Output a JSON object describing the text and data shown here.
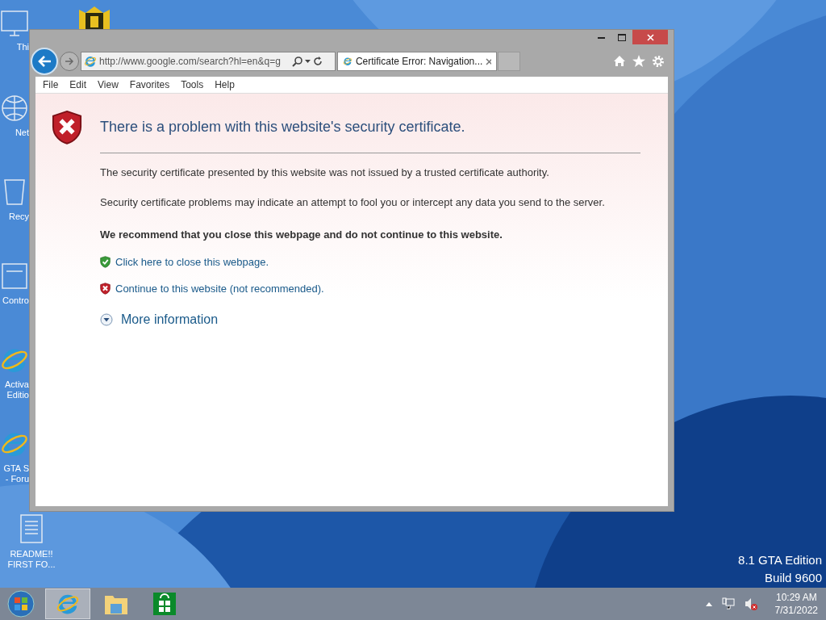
{
  "desktop_icons": [
    {
      "kind": "computer",
      "label": "Thi"
    },
    {
      "kind": "network",
      "label": "Net"
    },
    {
      "kind": "recycle",
      "label": "Recy"
    },
    {
      "kind": "control",
      "label": "Contro"
    },
    {
      "kind": "ie",
      "label": "Activa\nEditio"
    },
    {
      "kind": "ie",
      "label": "GTA S\n- Foru"
    },
    {
      "kind": "document",
      "label": "README!!\nFIRST FO..."
    }
  ],
  "browser": {
    "address": "http://www.google.com/search?hl=en&q=g",
    "tab_title": "Certificate Error: Navigation...",
    "menu": [
      "File",
      "Edit",
      "View",
      "Favorites",
      "Tools",
      "Help"
    ]
  },
  "page": {
    "heading": "There is a problem with this website's security certificate.",
    "paragraphs": [
      "The security certificate presented by this website was not issued by a trusted certificate authority.",
      "Security certificate problems may indicate an attempt to fool you or intercept any data you send to the server."
    ],
    "recommendation": "We recommend that you close this webpage and do not continue to this website.",
    "links": [
      {
        "kind": "safe",
        "text": "Click here to close this webpage."
      },
      {
        "kind": "unsafe",
        "text": "Continue to this website (not recommended)."
      }
    ],
    "more_info": {
      "text": "More information",
      "expanded": false
    }
  },
  "watermark": [
    "8.1 GTA Edition",
    "Build 9600"
  ],
  "taskbar": {
    "apps": [
      {
        "kind": "ie",
        "selected": true
      },
      {
        "kind": "explorer",
        "selected": false
      },
      {
        "kind": "store",
        "selected": false
      }
    ],
    "time": "10:29 AM",
    "date": "7/31/2022"
  }
}
